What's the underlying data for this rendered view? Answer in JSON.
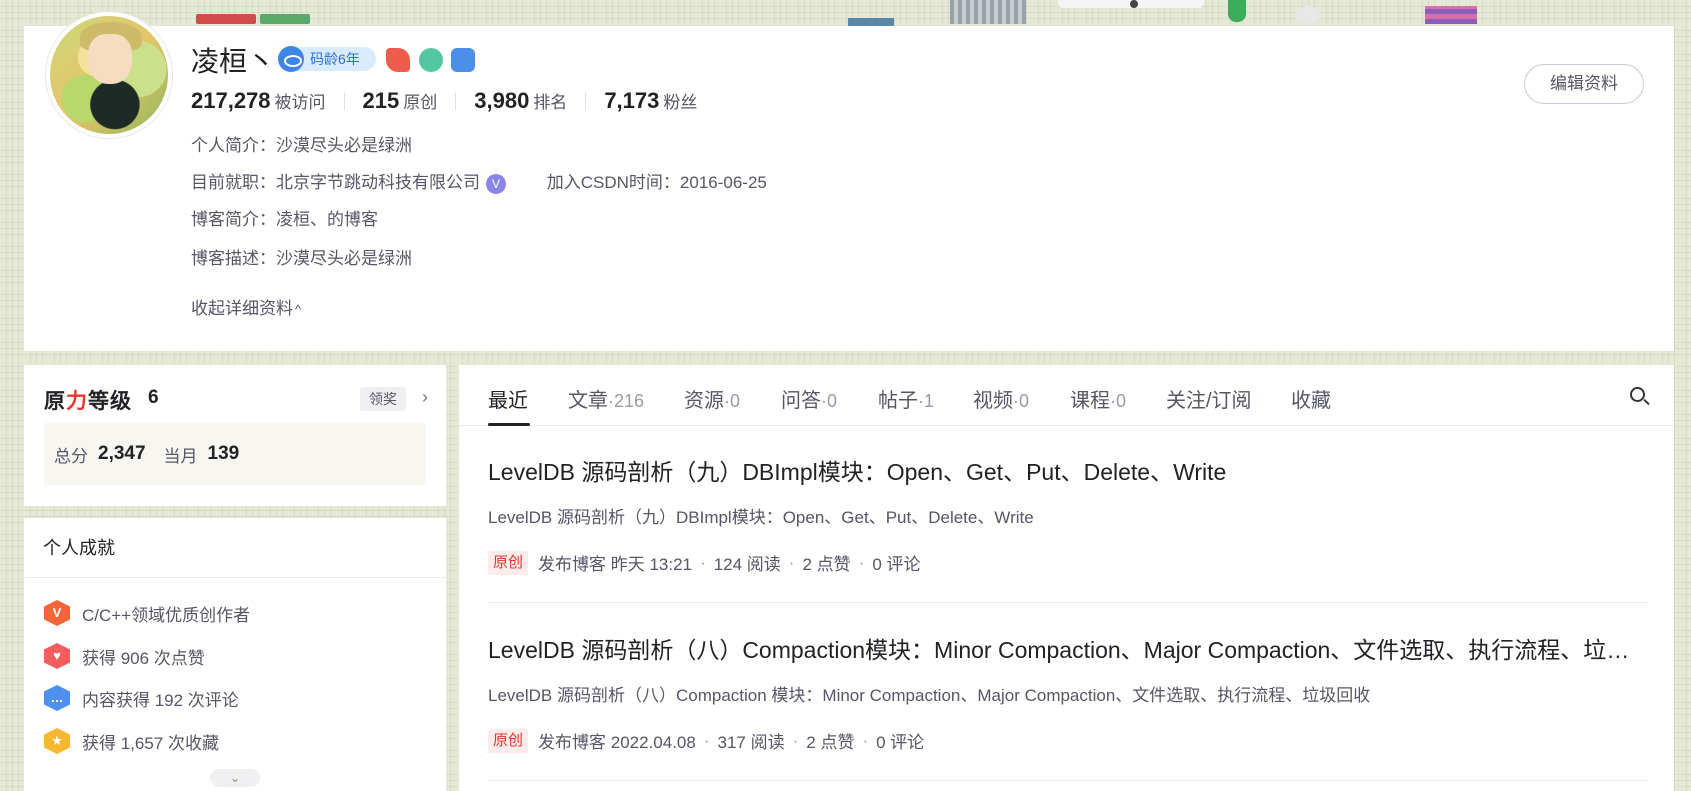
{
  "profile": {
    "name": "凌桓丶",
    "code_age_badge": "码龄6年",
    "stats": [
      {
        "value": "217,278",
        "label": "被访问"
      },
      {
        "value": "215",
        "label": "原创"
      },
      {
        "value": "3,980",
        "label": "排名"
      },
      {
        "value": "7,173",
        "label": "粉丝"
      }
    ],
    "intro_label": "个人简介：",
    "intro": "沙漠尽头必是绿洲",
    "job_label": "目前就职：",
    "job": "北京字节跳动科技有限公司",
    "verified_mark": "V",
    "join_label": "加入CSDN时间：",
    "join_date": "2016-06-25",
    "blog_intro_label": "博客简介：",
    "blog_intro": "凌桓、的博客",
    "blog_desc_label": "博客描述：",
    "blog_desc": "沙漠尽头必是绿洲",
    "collapse": "收起详细资料",
    "collapse_arrow": "^",
    "edit_button": "编辑资料"
  },
  "level": {
    "title_a": "原",
    "title_red": "力",
    "title_b": "等级",
    "value": "6",
    "claim": "领奖",
    "arrow": "›",
    "total_label": "总分",
    "total": "2,347",
    "month_label": "当月",
    "month": "139"
  },
  "achievements": {
    "title": "个人成就",
    "items": [
      {
        "icon": "v-badge-icon",
        "glyph": "V",
        "text": "C/C++领域优质创作者"
      },
      {
        "icon": "like-badge-icon",
        "glyph": "♥",
        "text": "获得 906 次点赞"
      },
      {
        "icon": "comment-badge-icon",
        "glyph": "…",
        "text": "内容获得 192 次评论"
      },
      {
        "icon": "star-badge-icon",
        "glyph": "★",
        "text": "获得 1,657 次收藏"
      }
    ],
    "more": "⌄"
  },
  "tabs": [
    {
      "label": "最近",
      "count": ""
    },
    {
      "label": "文章",
      "count": "·216"
    },
    {
      "label": "资源",
      "count": "·0"
    },
    {
      "label": "问答",
      "count": "·0"
    },
    {
      "label": "帖子",
      "count": "·1"
    },
    {
      "label": "视频",
      "count": "·0"
    },
    {
      "label": "课程",
      "count": "·0"
    },
    {
      "label": "关注/订阅",
      "count": ""
    },
    {
      "label": "收藏",
      "count": ""
    }
  ],
  "articles": [
    {
      "title": "LevelDB 源码剖析（九）DBImpl模块：Open、Get、Put、Delete、Write",
      "desc": "LevelDB 源码剖析（九）DBImpl模块：Open、Get、Put、Delete、Write",
      "tag": "原创",
      "published": "发布博客 昨天 13:21",
      "reads": "124 阅读",
      "likes": "2 点赞",
      "comments": "0 评论"
    },
    {
      "title": "LevelDB 源码剖析（八）Compaction模块：Minor Compaction、Major Compaction、文件选取、执行流程、垃圾回收",
      "desc": "LevelDB 源码剖析（八）Compaction 模块：Minor Compaction、Major Compaction、文件选取、执行流程、垃圾回收",
      "tag": "原创",
      "published": "发布博客 2022.04.08",
      "reads": "317 阅读",
      "likes": "2 点赞",
      "comments": "0 评论"
    }
  ],
  "meta_sep": "·",
  "colors": {
    "accent_red": "#e6352b",
    "text_primary": "#222226",
    "text_secondary": "#555666",
    "badge_blue": "#3e86e6"
  }
}
